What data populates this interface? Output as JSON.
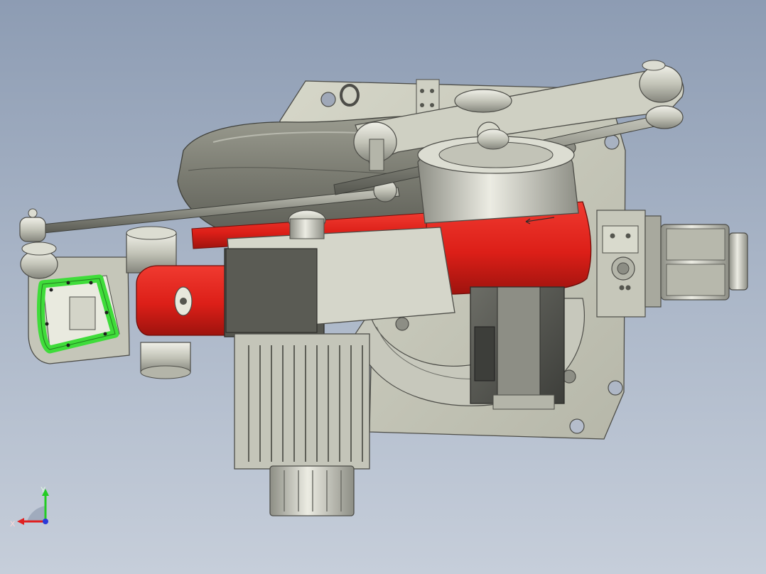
{
  "viewport": {
    "background_top": "#8d9cb3",
    "background_bottom": "#c6ceda"
  },
  "colors": {
    "plate": "#c8c9bb",
    "plate_edge": "#4d4d48",
    "metal_light": "#d6d7cc",
    "metal_mid": "#a9aa9f",
    "metal_dark": "#6e6f68",
    "red_housing": "#e0241d",
    "red_shade": "#a81611",
    "motor_dark": "#4f4f4b",
    "green_pcb": "#3fdc3a",
    "axis_x": "#e02020",
    "axis_y": "#22cc22",
    "axis_z": "#2a3ad8"
  },
  "triad": {
    "x_label": "X",
    "y_label": "Y",
    "icon": "coordinate-triad-icon"
  }
}
